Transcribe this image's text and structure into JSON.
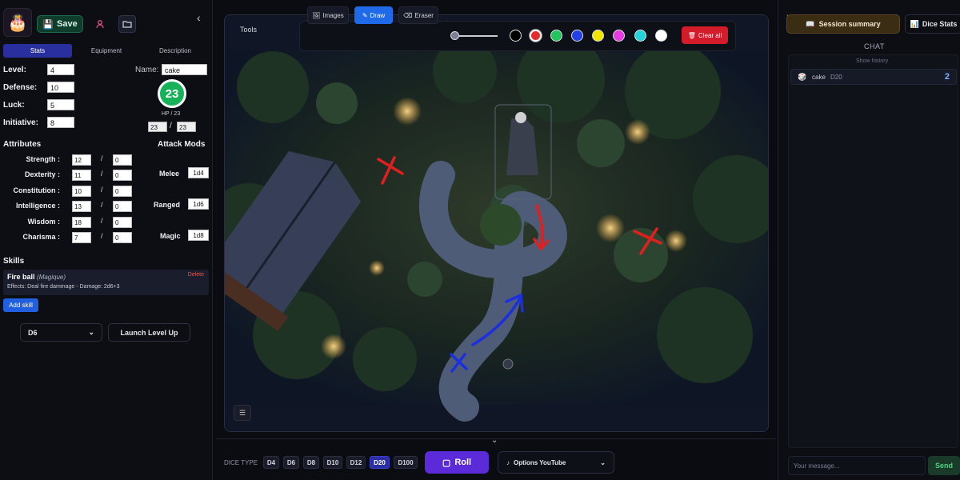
{
  "left": {
    "save_label": "Save",
    "tabs": [
      "Stats",
      "Equipment",
      "Description"
    ],
    "level_label": "Level:",
    "level": "4",
    "defense_label": "Defense:",
    "defense": "10",
    "luck_label": "Luck:",
    "luck": "5",
    "initiative_label": "Initiative:",
    "initiative": "8",
    "name_label": "Name:",
    "name": "cake",
    "hp_value": "23",
    "hp_text": "HP / 23",
    "hp_current": "23",
    "hp_max": "23",
    "attributes_title": "Attributes",
    "attack_mods_title": "Attack Mods",
    "attributes": [
      {
        "name": "Strength :",
        "value": "12",
        "mod": "0"
      },
      {
        "name": "Dexterity :",
        "value": "11",
        "mod": "0"
      },
      {
        "name": "Constitution :",
        "value": "10",
        "mod": "0"
      },
      {
        "name": "Intelligence :",
        "value": "13",
        "mod": "0"
      },
      {
        "name": "Wisdom :",
        "value": "18",
        "mod": "0"
      },
      {
        "name": "Charisma :",
        "value": "7",
        "mod": "0"
      }
    ],
    "attack_mods": [
      {
        "name": "Melee",
        "value": "1d4"
      },
      {
        "name": "Ranged",
        "value": "1d6"
      },
      {
        "name": "Magic",
        "value": "1d8"
      }
    ],
    "skills_title": "Skills",
    "skill": {
      "name": "Fire ball",
      "type": "(Magique)",
      "delete": "Delete",
      "effects": "Effects: Deal fire dammage - Damage: 2d6+3"
    },
    "add_skill": "Add skill",
    "dice_select": "D6",
    "level_up": "Launch Level Up"
  },
  "center": {
    "tools_label": "Tools",
    "toolbar": {
      "images": "Images",
      "draw": "Draw",
      "eraser": "Eraser",
      "clear_all": "Clear all"
    },
    "colors": [
      "#000000",
      "#e52b2b",
      "#22c55e",
      "#2340e8",
      "#f2e600",
      "#e53be0",
      "#22d3d8",
      "#ffffff"
    ],
    "selected_color": "#e52b2b",
    "brush_level": 0.05,
    "dice_type_label": "DICE TYPE",
    "dice": [
      "D4",
      "D6",
      "D8",
      "D10",
      "D12",
      "D20",
      "D100"
    ],
    "selected_die": "D20",
    "roll_label": "Roll",
    "youtube_label": "Options YouTube"
  },
  "right": {
    "session_summary": "Session summary",
    "dice_stats": "Dice Stats",
    "chat_title": "CHAT",
    "show_history": "Show history",
    "message": {
      "user": "cake",
      "die": "D20",
      "result": "2"
    },
    "input_placeholder": "Your message...",
    "send": "Send"
  }
}
